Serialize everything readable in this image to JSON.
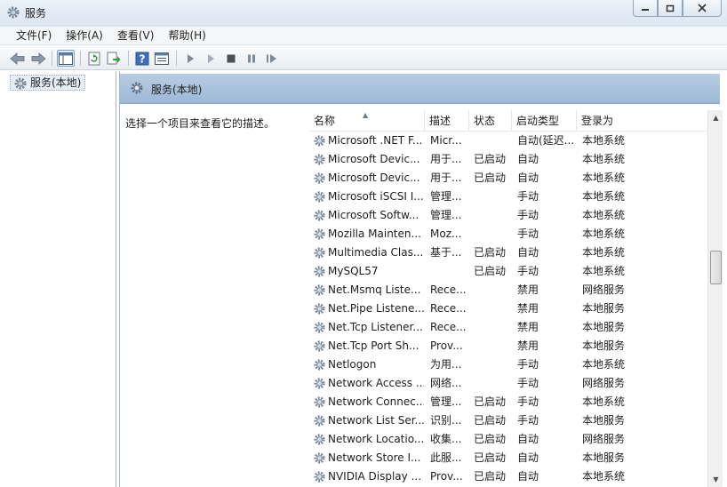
{
  "window": {
    "title": "服务",
    "minimize_icon": "minimize-icon",
    "maximize_icon": "maximize-icon",
    "close_icon": "close-icon"
  },
  "menu": [
    "文件(F)",
    "操作(A)",
    "查看(V)",
    "帮助(H)"
  ],
  "toolbar": {
    "buttons": [
      "back-icon",
      "forward-icon",
      "show-tree-icon",
      "refresh-icon",
      "export-icon",
      "help-icon",
      "properties-icon",
      "start-icon",
      "start-alt-icon",
      "stop-icon",
      "pause-icon",
      "resume-icon"
    ]
  },
  "tree": {
    "root_label": "服务(本地)"
  },
  "right_pane": {
    "header_title": "服务(本地)",
    "description_prompt": "选择一个项目来查看它的描述。"
  },
  "list": {
    "columns": [
      "名称",
      "描述",
      "状态",
      "启动类型",
      "登录为"
    ],
    "rows": [
      {
        "name": "Microsoft .NET F...",
        "desc": "Micr...",
        "status": "",
        "startup": "自动(延迟...",
        "logon": "本地系统"
      },
      {
        "name": "Microsoft Devic...",
        "desc": "用于...",
        "status": "已启动",
        "startup": "自动",
        "logon": "本地系统"
      },
      {
        "name": "Microsoft Devic...",
        "desc": "用于...",
        "status": "已启动",
        "startup": "自动",
        "logon": "本地系统"
      },
      {
        "name": "Microsoft iSCSI I...",
        "desc": "管理...",
        "status": "",
        "startup": "手动",
        "logon": "本地系统"
      },
      {
        "name": "Microsoft Softw...",
        "desc": "管理...",
        "status": "",
        "startup": "手动",
        "logon": "本地系统"
      },
      {
        "name": "Mozilla Mainten...",
        "desc": "Moz...",
        "status": "",
        "startup": "手动",
        "logon": "本地系统"
      },
      {
        "name": "Multimedia Clas...",
        "desc": "基于...",
        "status": "已启动",
        "startup": "自动",
        "logon": "本地系统"
      },
      {
        "name": "MySQL57",
        "desc": "",
        "status": "已启动",
        "startup": "手动",
        "logon": "本地系统"
      },
      {
        "name": "Net.Msmq Liste...",
        "desc": "Rece...",
        "status": "",
        "startup": "禁用",
        "logon": "网络服务"
      },
      {
        "name": "Net.Pipe Listene...",
        "desc": "Rece...",
        "status": "",
        "startup": "禁用",
        "logon": "本地服务"
      },
      {
        "name": "Net.Tcp Listener...",
        "desc": "Rece...",
        "status": "",
        "startup": "禁用",
        "logon": "本地服务"
      },
      {
        "name": "Net.Tcp Port Sh...",
        "desc": "Prov...",
        "status": "",
        "startup": "禁用",
        "logon": "本地服务"
      },
      {
        "name": "Netlogon",
        "desc": "为用...",
        "status": "",
        "startup": "手动",
        "logon": "本地系统"
      },
      {
        "name": "Network Access ...",
        "desc": "网络...",
        "status": "",
        "startup": "手动",
        "logon": "网络服务"
      },
      {
        "name": "Network Connec...",
        "desc": "管理...",
        "status": "已启动",
        "startup": "手动",
        "logon": "本地系统"
      },
      {
        "name": "Network List Ser...",
        "desc": "识别...",
        "status": "已启动",
        "startup": "手动",
        "logon": "本地服务"
      },
      {
        "name": "Network Locatio...",
        "desc": "收集...",
        "status": "已启动",
        "startup": "自动",
        "logon": "网络服务"
      },
      {
        "name": "Network Store I...",
        "desc": "此服...",
        "status": "已启动",
        "startup": "自动",
        "logon": "本地服务"
      },
      {
        "name": "NVIDIA Display ...",
        "desc": "Prov...",
        "status": "已启动",
        "startup": "自动",
        "logon": "本地系统"
      }
    ]
  },
  "colors": {
    "header_blue": "#9db8d6",
    "title_bar": "#dbe6f3"
  }
}
